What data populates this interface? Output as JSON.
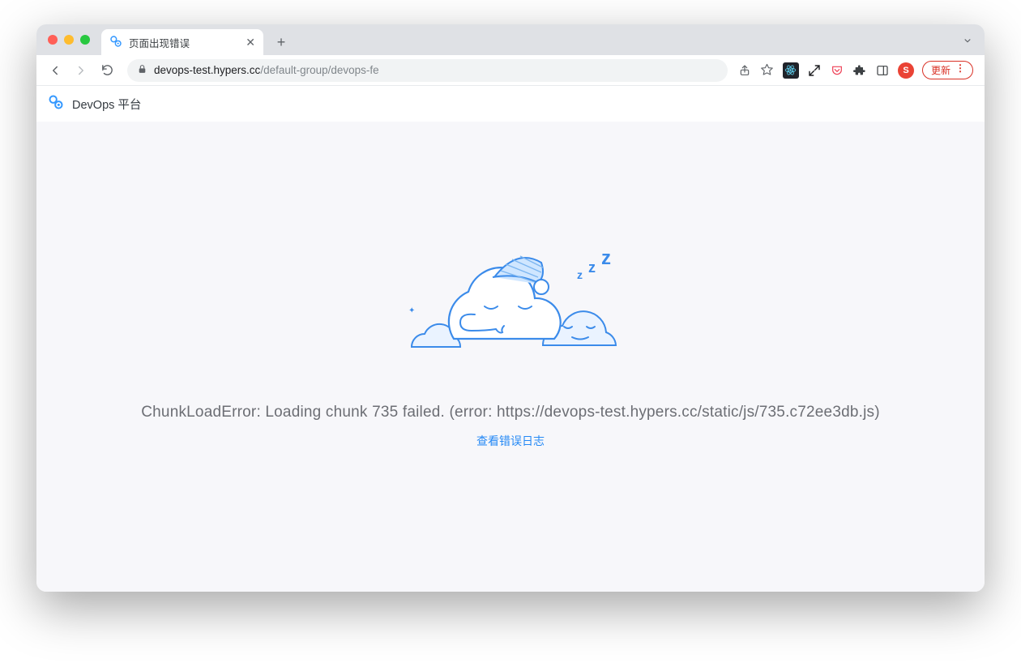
{
  "browser": {
    "tab_title": "页面出现错误",
    "url_host": "devops-test.hypers.cc",
    "url_path": "/default-group/devops-fe",
    "update_label": "更新",
    "avatar_letter": "S"
  },
  "app": {
    "title": "DevOps 平台"
  },
  "error": {
    "message": "ChunkLoadError: Loading chunk 735 failed. (error: https://devops-test.hypers.cc/static/js/735.c72ee3db.js)",
    "link_label": "查看错误日志"
  }
}
